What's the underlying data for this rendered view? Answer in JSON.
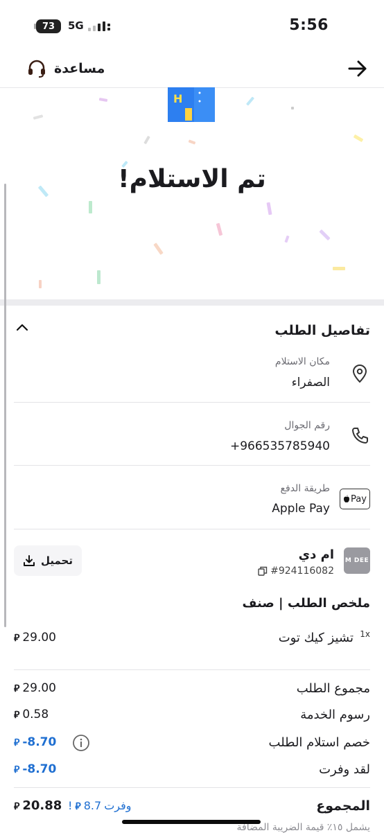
{
  "status_bar": {
    "time": "5:56",
    "battery": "73",
    "network": "5G"
  },
  "header": {
    "help_label": "مساعدة",
    "back_icon": "arrow-right-icon",
    "help_icon": "headset-icon"
  },
  "hero": {
    "title": "تم الاستلام!"
  },
  "order_details": {
    "title": "تفاصيل الطلب",
    "pickup_label": "مكان الاستلام",
    "pickup_value": "الصفراء",
    "phone_label": "رقم الجوال",
    "phone_value": "+966535785940",
    "payment_label": "طريقة الدفع",
    "payment_value": "Apple Pay",
    "payment_badge": "Pay"
  },
  "merchant": {
    "logo_text": "M DEE",
    "name": "ام دي",
    "order_number": "#924116082",
    "download_label": "تحميل"
  },
  "summary": {
    "title": "ملخص الطلب | صنف",
    "items": [
      {
        "qty": "1x",
        "name": "تشيز كيك توت",
        "price": "29.00"
      }
    ],
    "lines": [
      {
        "label": "مجموع الطلب",
        "amount": "29.00"
      },
      {
        "label": "رسوم الخدمة",
        "amount": "0.58"
      },
      {
        "label": "خصم استلام الطلب",
        "amount": "-8.70"
      },
      {
        "label": "لقد وفرت",
        "amount": "-8.70"
      }
    ],
    "total_label": "المجموع",
    "total_amount": "20.88",
    "saved_prefix": "وفرت",
    "saved_amount": "8.7",
    "saved_suffix": "!",
    "vat_note": "يشمل ١٥٪ قيمة الضريبة المضافة"
  },
  "colors": {
    "accent_blue": "#1f6fd1",
    "text": "#1b1b1f",
    "muted": "#6b6b72"
  }
}
